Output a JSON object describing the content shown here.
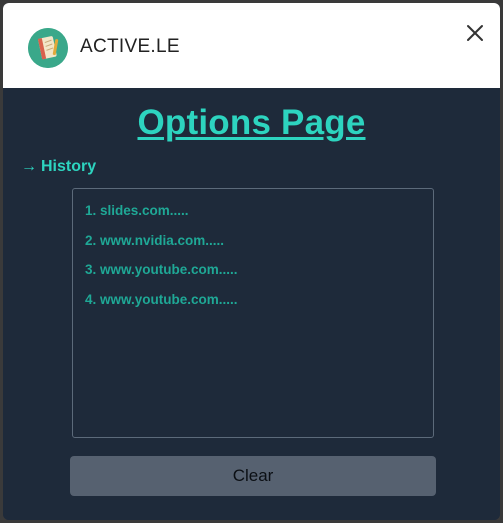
{
  "app": {
    "name": "ACTIVE.LE",
    "icon": "notebook-icon",
    "close_icon": "close-icon"
  },
  "page": {
    "title": "Options Page"
  },
  "history": {
    "arrow": "→",
    "heading": "History",
    "items": [
      "1. slides.com.....",
      "2. www.nvidia.com.....",
      "3. www.youtube.com.....",
      "4. www.youtube.com....."
    ]
  },
  "actions": {
    "clear_label": "Clear"
  },
  "colors": {
    "accent": "#2dd4bf",
    "list_text": "#1fa896",
    "background": "#1e2a3a",
    "button": "#566170"
  }
}
